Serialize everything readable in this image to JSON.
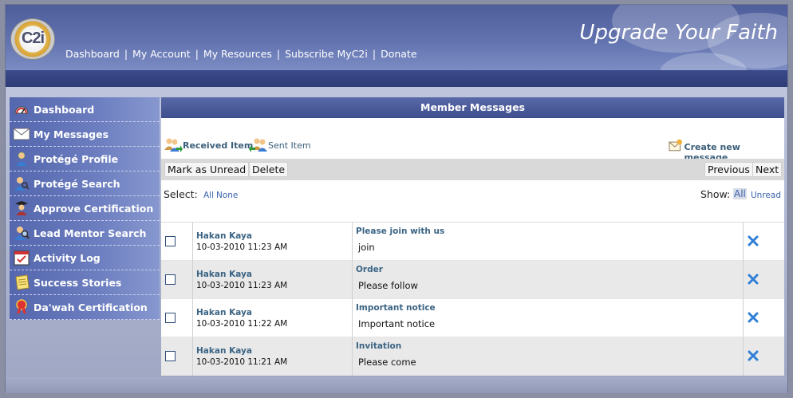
{
  "header": {
    "logo_text": "C2i",
    "tagline": "Upgrade Your Faith",
    "nav": [
      "Dashboard",
      "My Account",
      "My Resources",
      "Subscribe MyC2i",
      "Donate"
    ]
  },
  "sidebar": {
    "items": [
      {
        "label": "Dashboard",
        "icon": "gauge-icon"
      },
      {
        "label": "My Messages",
        "icon": "envelope-icon"
      },
      {
        "label": "Protégé Profile",
        "icon": "person-icon"
      },
      {
        "label": "Protégé Search",
        "icon": "person-search-icon"
      },
      {
        "label": "Approve Certification",
        "icon": "graduate-icon"
      },
      {
        "label": "Lead Mentor Search",
        "icon": "magnifier-person-icon"
      },
      {
        "label": "Activity Log",
        "icon": "calendar-icon"
      },
      {
        "label": "Success Stories",
        "icon": "notepad-icon"
      },
      {
        "label": "Da'wah Certification",
        "icon": "ribbon-icon"
      }
    ]
  },
  "panel": {
    "title": "Member Messages",
    "folders": {
      "received": "Received Item",
      "sent": "Sent Item",
      "create": "Create new message"
    },
    "toolbar": {
      "mark_unread": "Mark as Unread",
      "delete": "Delete",
      "previous": "Previous",
      "next": "Next"
    },
    "select": {
      "label": "Select:",
      "all": "All",
      "none": "None"
    },
    "show": {
      "label": "Show:",
      "all": "All",
      "unread": "Unread"
    }
  },
  "messages": [
    {
      "sender": "Hakan Kaya",
      "date": "10-03-2010 11:23 AM",
      "subject": "Please join with us",
      "preview": "join"
    },
    {
      "sender": "Hakan Kaya",
      "date": "10-03-2010 11:23 AM",
      "subject": "Order",
      "preview": "Please follow"
    },
    {
      "sender": "Hakan Kaya",
      "date": "10-03-2010 11:22 AM",
      "subject": "Important notice",
      "preview": "Important notice"
    },
    {
      "sender": "Hakan Kaya",
      "date": "10-03-2010 11:21 AM",
      "subject": "Invitation",
      "preview": "Please come"
    }
  ],
  "colors": {
    "header": "#5566a6",
    "accent_link": "#3b6484",
    "delete_x": "#2f7fd6"
  }
}
